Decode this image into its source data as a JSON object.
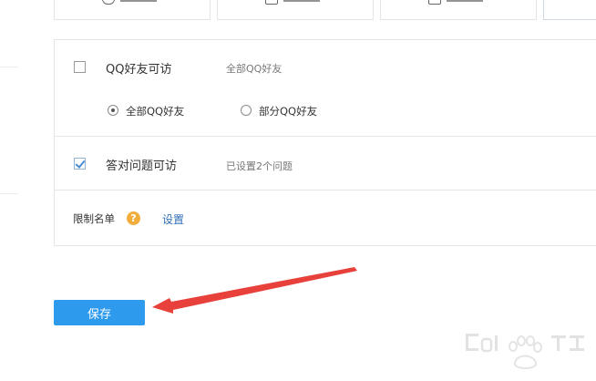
{
  "tabs": [
    "",
    "",
    "",
    ""
  ],
  "qq_friends": {
    "label": "QQ好友可访",
    "note": "全部QQ好友",
    "checked": false,
    "options": [
      {
        "label": "全部QQ好友",
        "selected": true
      },
      {
        "label": "部分QQ好友",
        "selected": false
      }
    ]
  },
  "answer_question": {
    "label": "答对问题可访",
    "note": "已设置2个问题",
    "checked": true
  },
  "restriction_list": {
    "label": "限制名单",
    "help_glyph": "?",
    "link": "设置"
  },
  "save_button": "保存",
  "colors": {
    "accent_blue": "#2d9aee",
    "arrow_red": "#e8413b",
    "help_orange": "#f2ae3d",
    "link_blue": "#2f6db5"
  }
}
